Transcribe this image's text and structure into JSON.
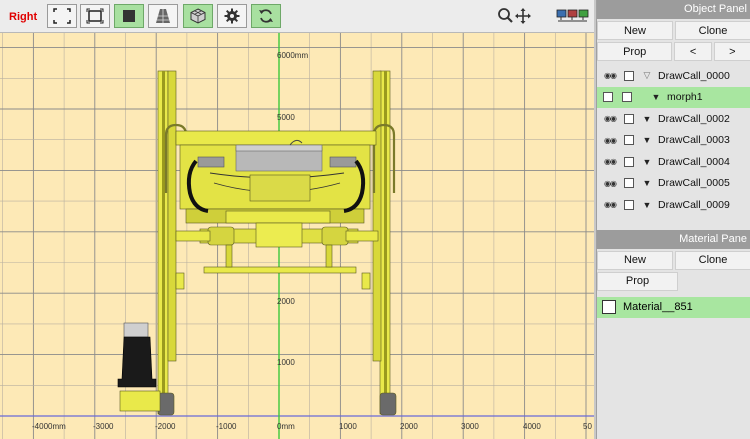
{
  "toolbar": {
    "view_name": "Right",
    "buttons": [
      "select-box",
      "frame",
      "solid-shading",
      "perspective",
      "cube-view",
      "settings",
      "refresh"
    ],
    "active_buttons": [
      "solid-shading",
      "cube-view",
      "refresh"
    ]
  },
  "viewport": {
    "x_tick_labels": [
      "-4000mm",
      "-3000",
      "-2000",
      "-1000",
      "0mm",
      "1000",
      "2000",
      "3000",
      "4000",
      "50"
    ],
    "y_tick_labels": [
      "6000mm",
      "5000",
      "4000",
      "3000",
      "2000",
      "1000"
    ],
    "background_color": "#fde9b6",
    "model_color": "#e9e94a"
  },
  "object_panel": {
    "title": "Object Panel",
    "new_label": "New",
    "clone_label": "Clone",
    "prop_label": "Prop",
    "prev_label": "<",
    "next_label": ">",
    "items": [
      {
        "label": "DrawCall_0000",
        "visible": true,
        "expanded": false
      },
      {
        "label": "morph1",
        "visible": false,
        "expanded": true,
        "selected": true
      },
      {
        "label": "DrawCall_0002",
        "visible": true,
        "expanded": true
      },
      {
        "label": "DrawCall_0003",
        "visible": true,
        "expanded": true
      },
      {
        "label": "DrawCall_0004",
        "visible": true,
        "expanded": true
      },
      {
        "label": "DrawCall_0005",
        "visible": true,
        "expanded": true
      },
      {
        "label": "DrawCall_0009",
        "visible": true,
        "expanded": true
      }
    ]
  },
  "material_panel": {
    "title": "Material Pane",
    "new_label": "New",
    "clone_label": "Clone",
    "prop_label": "Prop",
    "items": [
      {
        "label": "Material__851"
      }
    ]
  }
}
